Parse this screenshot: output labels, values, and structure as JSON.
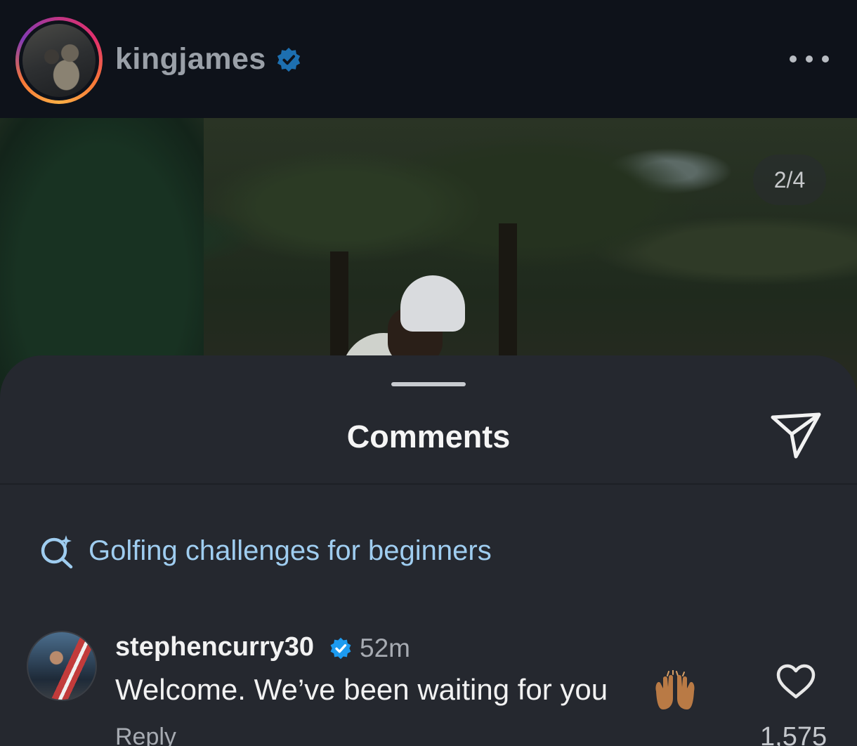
{
  "post": {
    "username": "kingjames",
    "verified": true,
    "more_icon": "more-horizontal-icon"
  },
  "media": {
    "counter": "2/4"
  },
  "comments_sheet": {
    "title": "Comments",
    "share_icon": "send-icon",
    "search_suggestion": {
      "icon": "ai-search-icon",
      "text": "Golfing challenges for beginners"
    },
    "comments": [
      {
        "username": "stephencurry30",
        "verified": true,
        "time": "52m",
        "text": "Welcome. We’ve been waiting for you",
        "emoji_icon": "raising-hands-emoji-icon",
        "reply_label": "Reply",
        "like_count": "1,575",
        "like_icon": "heart-outline-icon"
      }
    ]
  },
  "colors": {
    "header_bg": "#0e121a",
    "sheet_bg": "#25282f",
    "verified_blue": "#1d9bf0",
    "suggestion_blue": "#9fcdf0"
  }
}
